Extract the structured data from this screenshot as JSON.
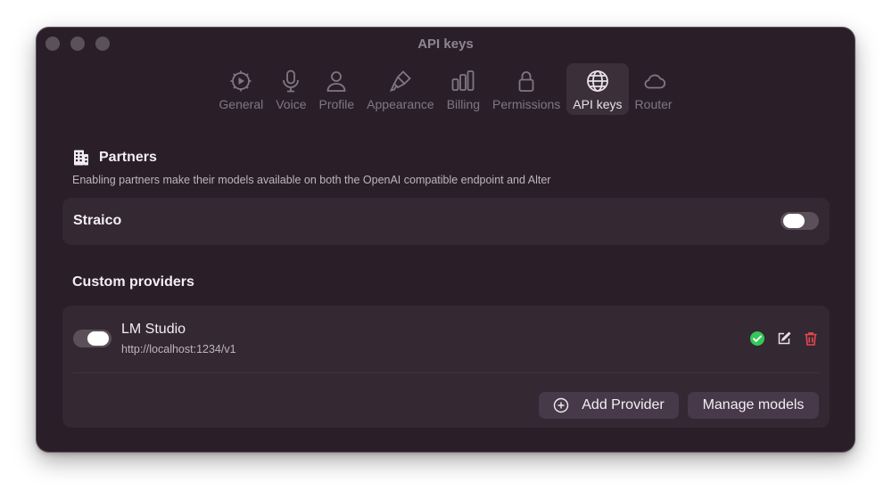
{
  "window": {
    "title": "API keys"
  },
  "toolbar": {
    "tabs": [
      {
        "label": "General",
        "icon": "gear-play-icon",
        "active": false
      },
      {
        "label": "Voice",
        "icon": "microphone-icon",
        "active": false
      },
      {
        "label": "Profile",
        "icon": "person-icon",
        "active": false
      },
      {
        "label": "Appearance",
        "icon": "paintbrush-icon",
        "active": false
      },
      {
        "label": "Billing",
        "icon": "bar-chart-icon",
        "active": false
      },
      {
        "label": "Permissions",
        "icon": "lock-icon",
        "active": false
      },
      {
        "label": "API keys",
        "icon": "globe-icon",
        "active": true
      },
      {
        "label": "Router",
        "icon": "cloud-icon",
        "active": false
      }
    ]
  },
  "partners": {
    "title": "Partners",
    "icon": "building-icon",
    "description": "Enabling partners make their models available on both the OpenAI compatible endpoint and Alter",
    "items": [
      {
        "name": "Straico",
        "enabled": false
      }
    ]
  },
  "custom_providers": {
    "title": "Custom providers",
    "items": [
      {
        "name": "LM Studio",
        "url": "http://localhost:1234/v1",
        "enabled": true,
        "status": "connected"
      }
    ],
    "add_label": "Add Provider",
    "manage_label": "Manage models"
  },
  "colors": {
    "window_bg": "#2a1f29",
    "card_bg": "#342833",
    "accent_green": "#34c759",
    "delete_red": "#e5484d"
  }
}
